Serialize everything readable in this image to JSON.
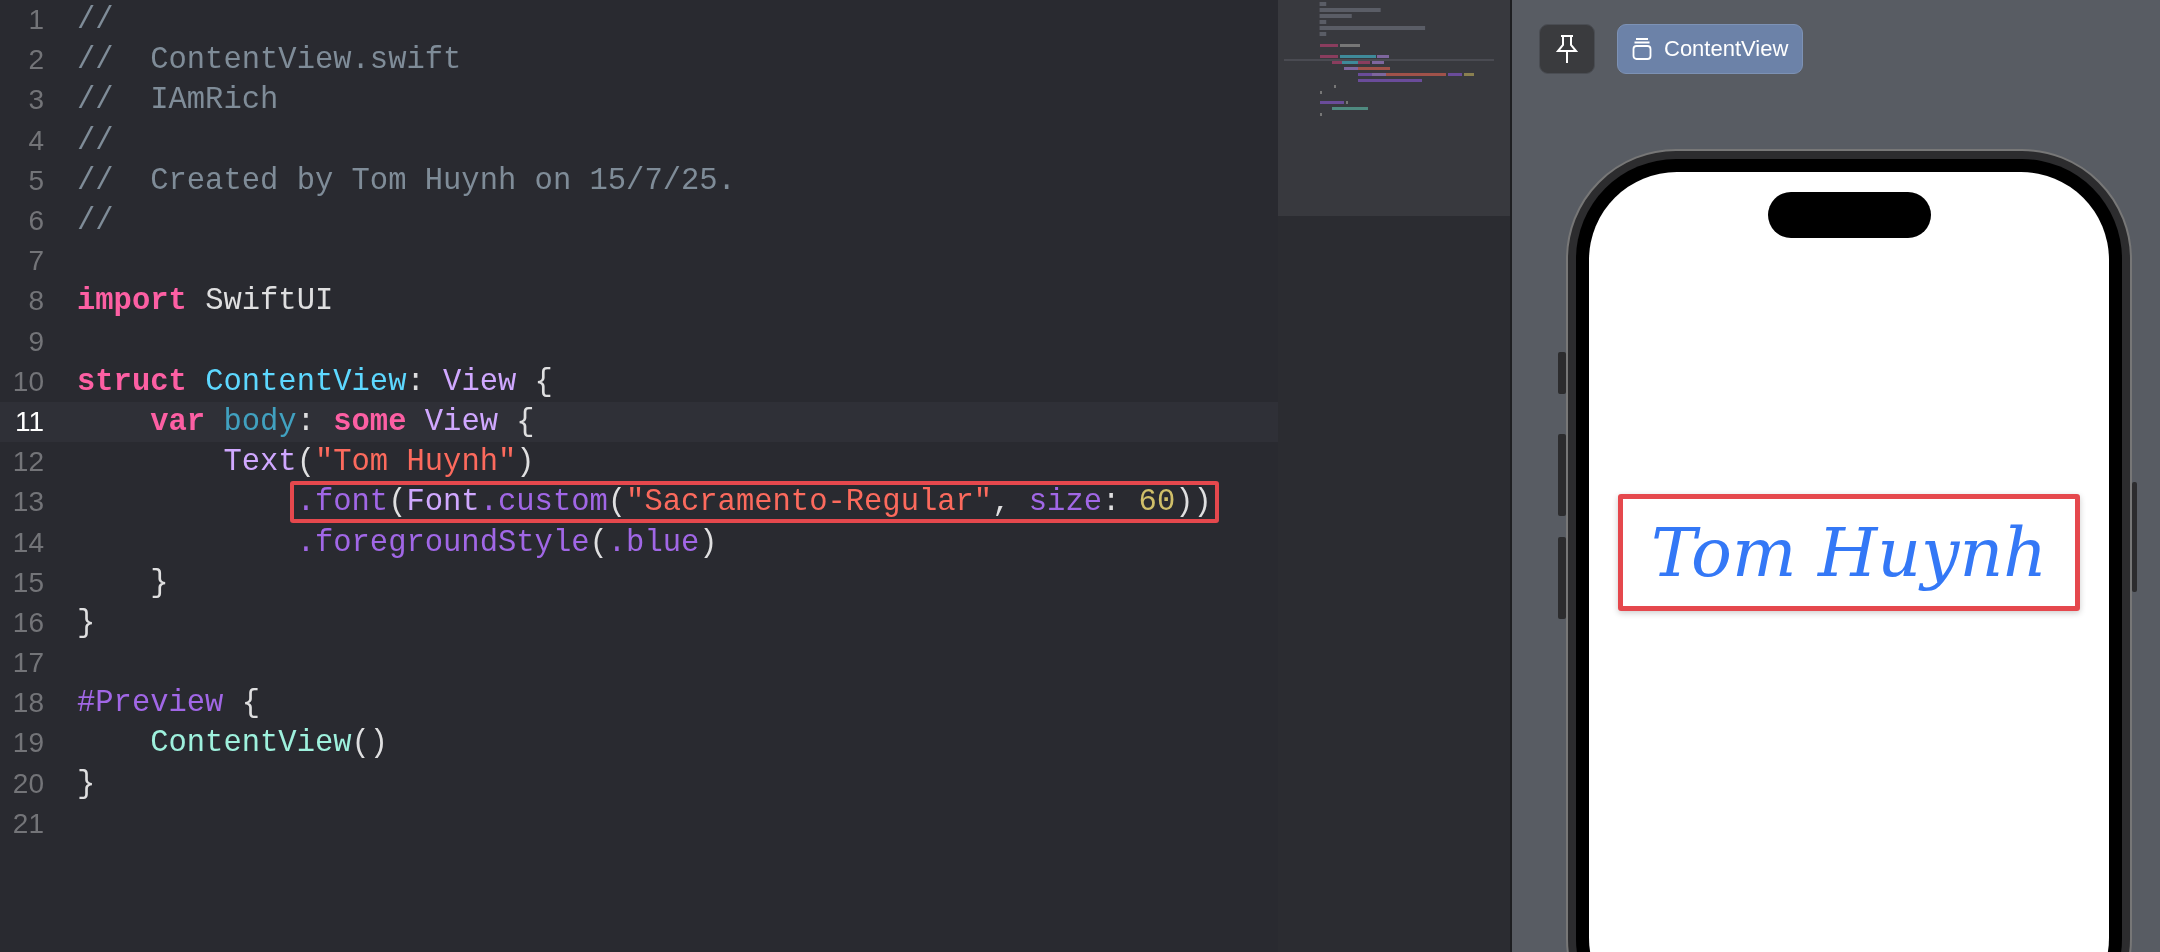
{
  "editor": {
    "lines": [
      {
        "number": "1",
        "current": false,
        "tokens": [
          {
            "kind": "comment",
            "text": "//"
          }
        ]
      },
      {
        "number": "2",
        "current": false,
        "tokens": [
          {
            "kind": "comment",
            "text": "//  ContentView.swift"
          }
        ]
      },
      {
        "number": "3",
        "current": false,
        "tokens": [
          {
            "kind": "comment",
            "text": "//  IAmRich"
          }
        ]
      },
      {
        "number": "4",
        "current": false,
        "tokens": [
          {
            "kind": "comment",
            "text": "//"
          }
        ]
      },
      {
        "number": "5",
        "current": false,
        "tokens": [
          {
            "kind": "comment",
            "text": "//  Created by Tom Huynh on 15/7/25."
          }
        ]
      },
      {
        "number": "6",
        "current": false,
        "tokens": [
          {
            "kind": "comment",
            "text": "//"
          }
        ]
      },
      {
        "number": "7",
        "current": false
      },
      {
        "number": "8",
        "current": false,
        "tokens": [
          {
            "kind": "keyword",
            "text": "import"
          },
          {
            "kind": "plain",
            "text": " SwiftUI"
          }
        ]
      },
      {
        "number": "9",
        "current": false
      },
      {
        "number": "10",
        "current": false,
        "tokens": [
          {
            "kind": "keyword",
            "text": "struct"
          },
          {
            "kind": "declaration",
            "text": " ContentView"
          },
          {
            "kind": "plain",
            "text": ": "
          },
          {
            "kind": "type",
            "text": "View"
          },
          {
            "kind": "plain",
            "text": " {"
          }
        ]
      },
      {
        "number": "11",
        "current": true,
        "tokens": [
          {
            "kind": "keyword",
            "text": "    var"
          },
          {
            "kind": "property",
            "text": " body"
          },
          {
            "kind": "plain",
            "text": ": "
          },
          {
            "kind": "keyword",
            "text": "some"
          },
          {
            "kind": "type",
            "text": " View"
          },
          {
            "kind": "plain",
            "text": " {"
          }
        ]
      },
      {
        "number": "12",
        "current": false,
        "tokens": [
          {
            "kind": "type",
            "text": "        Text"
          },
          {
            "kind": "plain",
            "text": "("
          },
          {
            "kind": "string",
            "text": "\"Tom Huynh\""
          },
          {
            "kind": "plain",
            "text": ")"
          }
        ]
      },
      {
        "number": "13",
        "current": false,
        "boxed": true,
        "tokens": [
          {
            "kind": "method",
            "text": "            .font"
          },
          {
            "kind": "plain",
            "text": "("
          },
          {
            "kind": "type",
            "text": "Font"
          },
          {
            "kind": "method",
            "text": ".custom"
          },
          {
            "kind": "plain",
            "text": "("
          },
          {
            "kind": "string",
            "text": "\"Sacramento-Regular\""
          },
          {
            "kind": "plain",
            "text": ", "
          },
          {
            "kind": "method",
            "text": "size"
          },
          {
            "kind": "plain",
            "text": ": "
          },
          {
            "kind": "number",
            "text": "60"
          },
          {
            "kind": "plain",
            "text": "))"
          }
        ]
      },
      {
        "number": "14",
        "current": false,
        "tokens": [
          {
            "kind": "method",
            "text": "            .foregroundStyle"
          },
          {
            "kind": "plain",
            "text": "("
          },
          {
            "kind": "method",
            "text": ".blue"
          },
          {
            "kind": "plain",
            "text": ")"
          }
        ]
      },
      {
        "number": "15",
        "current": false,
        "tokens": [
          {
            "kind": "plain",
            "text": "    }"
          }
        ]
      },
      {
        "number": "16",
        "current": false,
        "tokens": [
          {
            "kind": "plain",
            "text": "}"
          }
        ]
      },
      {
        "number": "17",
        "current": false
      },
      {
        "number": "18",
        "current": false,
        "tokens": [
          {
            "kind": "macro",
            "text": "#Preview"
          },
          {
            "kind": "plain",
            "text": " {"
          }
        ]
      },
      {
        "number": "19",
        "current": false,
        "tokens": [
          {
            "kind": "call",
            "text": "    ContentView"
          },
          {
            "kind": "plain",
            "text": "()"
          }
        ]
      },
      {
        "number": "20",
        "current": false,
        "tokens": [
          {
            "kind": "plain",
            "text": "}"
          }
        ]
      },
      {
        "number": "21",
        "current": false
      }
    ]
  },
  "preview": {
    "pin_button": {
      "selected": false
    },
    "view_button": {
      "label": "ContentView",
      "selected": true
    },
    "text": "Tom Huynh",
    "boxed": true
  }
}
